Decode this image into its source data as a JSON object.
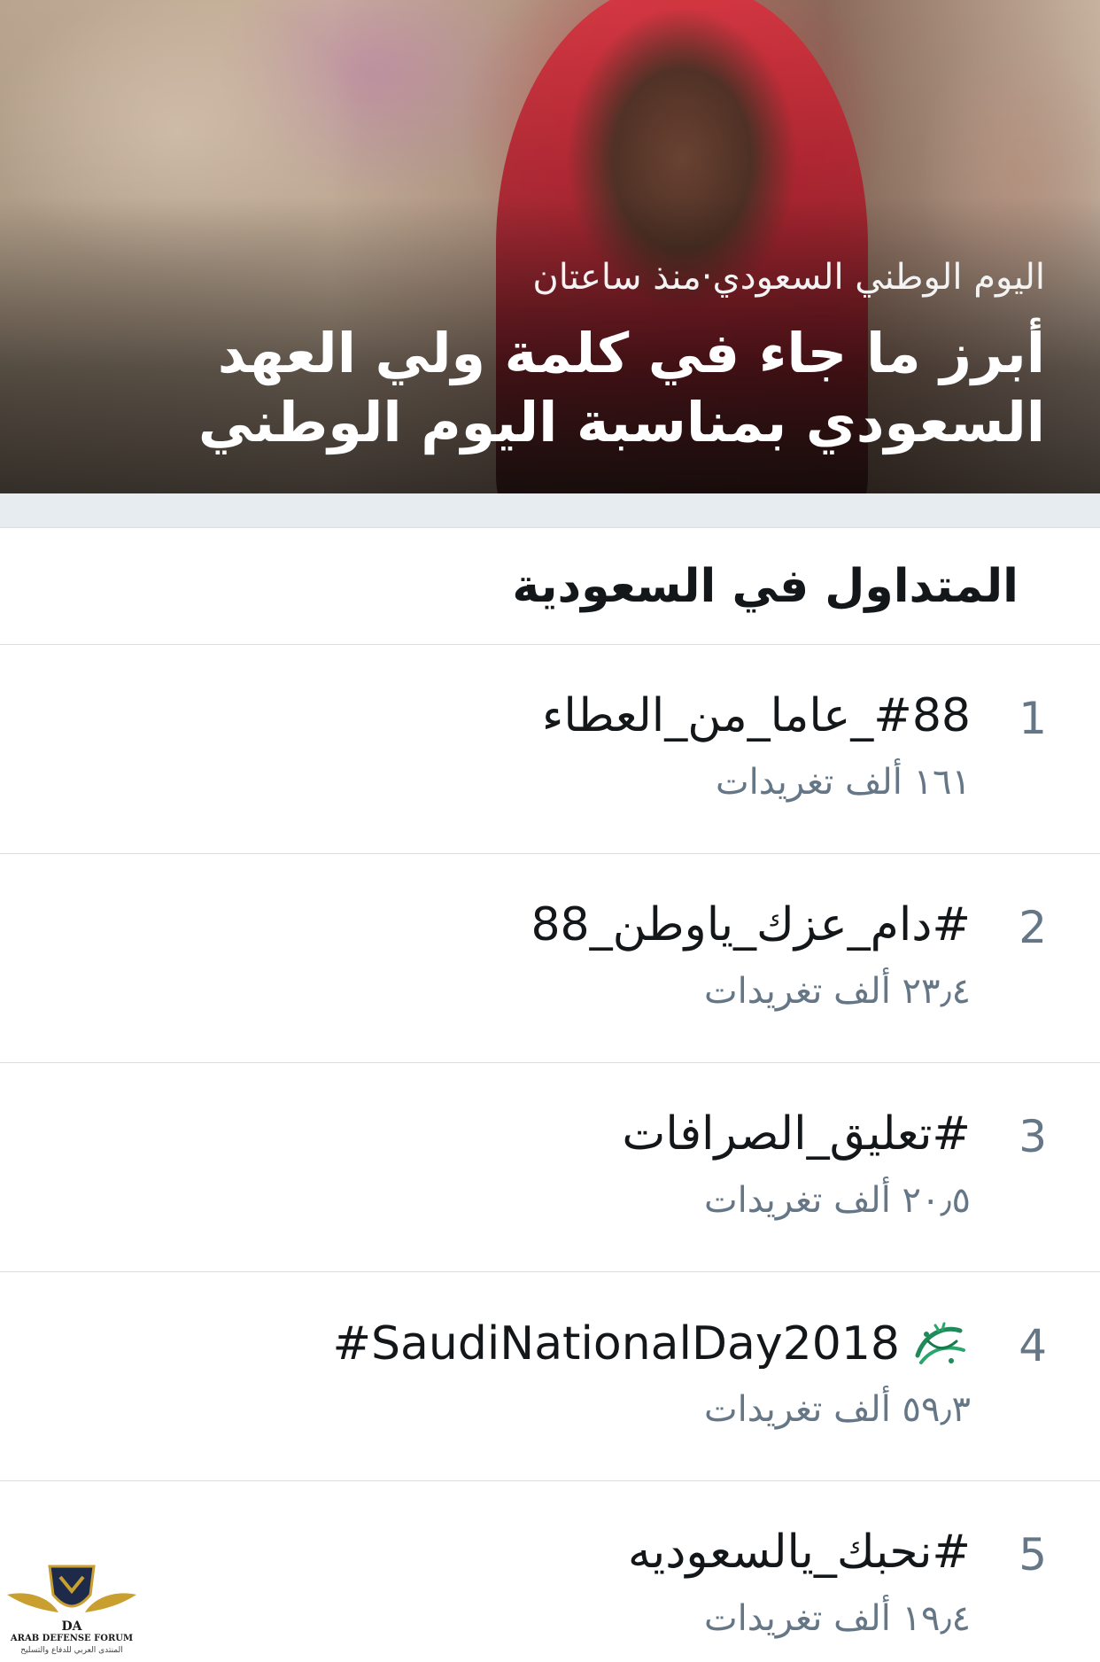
{
  "hero": {
    "meta": "اليوم الوطني السعودي·منذ ساعتان",
    "title": "أبرز ما جاء في كلمة ولي العهد السعودي بمناسبة اليوم الوطني"
  },
  "section": {
    "title": "المتداول في السعودية"
  },
  "trends": [
    {
      "rank": "1",
      "name": "#88_عاما_من_العطاء",
      "count": "١٦١ ألف تغريدات"
    },
    {
      "rank": "2",
      "name": "#دام_عزك_ياوطن_88",
      "count": "٢٣٫٤ ألف تغريدات"
    },
    {
      "rank": "3",
      "name": "#تعليق_الصرافات",
      "count": "٢٠٫٥ ألف تغريدات"
    },
    {
      "rank": "4",
      "name": "#SaudiNationalDay2018",
      "count": "٥٩٫٣ ألف تغريدات",
      "icon": "saudi-national-day-emoji-icon"
    },
    {
      "rank": "5",
      "name": "#نحبك_يالسعوديه",
      "count": "١٩٫٤ ألف تغريدات"
    }
  ],
  "watermark": {
    "line1": "ARAB DEFENSE FORUM",
    "line2": "المنتدى العربي للدفاع والتسليح"
  }
}
